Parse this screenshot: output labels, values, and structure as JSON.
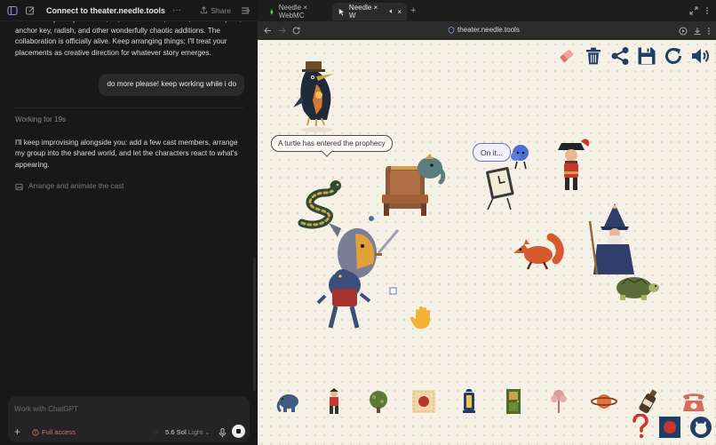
{
  "chat": {
    "title": "Connect to theater.needle.tools",
    "share_label": "Share",
    "assistant_msg_1": "I can already see your cloud, elf, cake-ther fox, throne, ribbon serpent, anchor key, radish, and other wonderfully chaotic additions. The collaboration is officially alive. Keep arranging things; I'll treat your placements as creative direction for whatever story emerges.",
    "user_msg": "do more please! keep working while i do",
    "working_status": "Working for 19s",
    "assistant_msg_2": "I'll keep improvising alongside you: add a few cast members, arrange my group into the shared world, and let the characters react to what's appearing.",
    "task_label": "Arrange and animate the cast",
    "composer_placeholder": "Work with ChatGPT",
    "access_label": "Full access",
    "model_name": "5.6 Sol",
    "model_mode": "Light"
  },
  "browser": {
    "tabs": [
      {
        "label": "Needle × WebMC"
      },
      {
        "label": "Needle × W"
      }
    ],
    "url": "theater.needle.tools"
  },
  "stage": {
    "speech_turtle": "A turtle has entered the prophecy",
    "speech_onit": "On it..."
  },
  "colors": {
    "stage_bg": "#f6f1e7",
    "accent_red": "#e0726b",
    "toolbar_blue": "#1f3f66"
  }
}
